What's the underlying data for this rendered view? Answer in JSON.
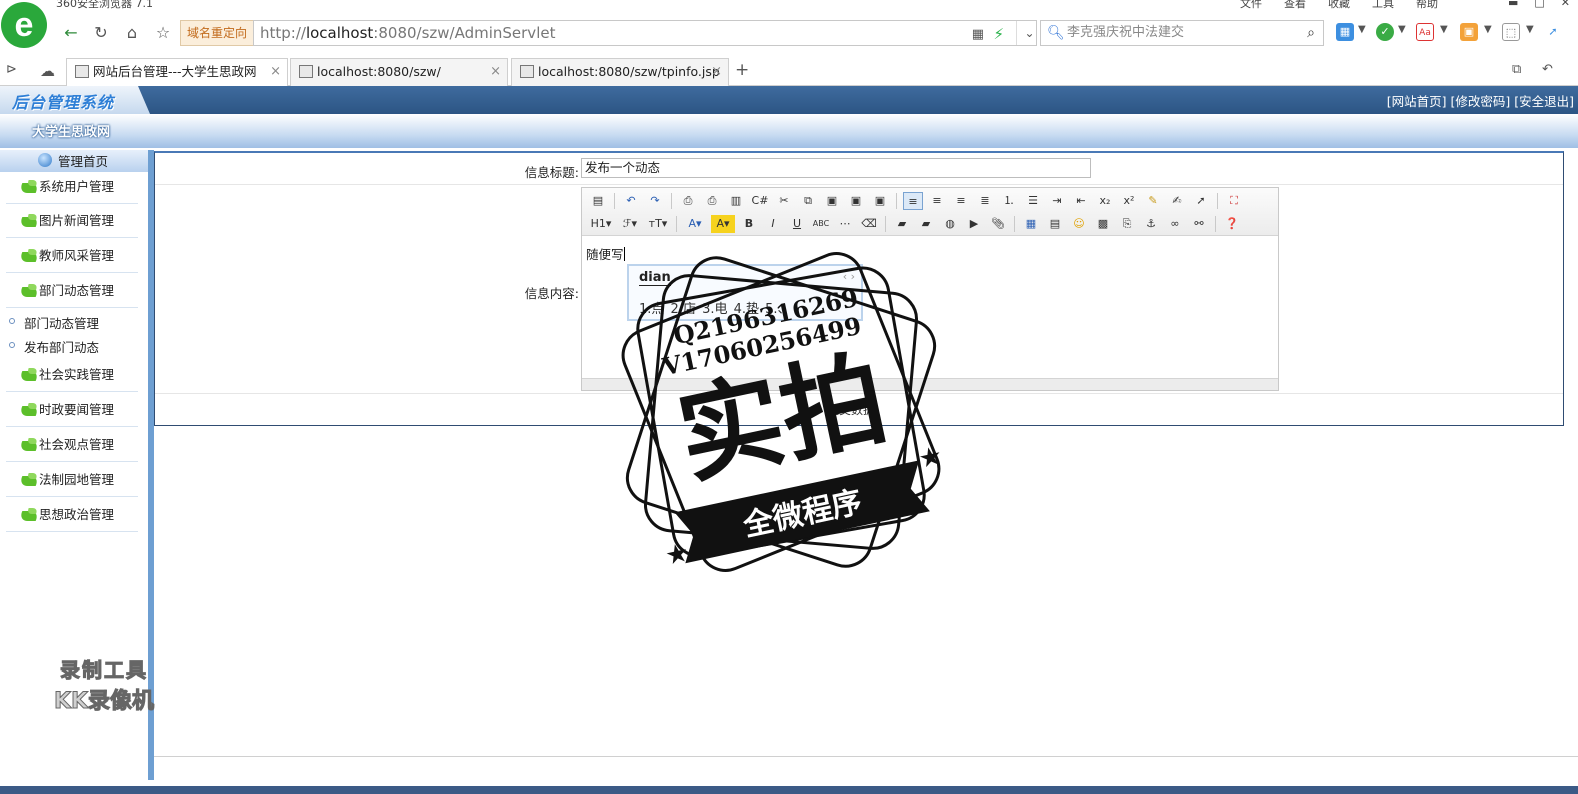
{
  "browser": {
    "title": "360安全浏览器 7.1",
    "menu": [
      "文件",
      "查看",
      "收藏",
      "工具",
      "帮助"
    ],
    "redirect_label": "域名重定向",
    "url_prefix": "http://",
    "url_host": "localhost",
    "url_rest": ":8080/szw/AdminServlet",
    "search_placeholder": "李克强庆祝中法建交",
    "tabs": [
      {
        "label": "网站后台管理---大学生思政网"
      },
      {
        "label": "localhost:8080/szw/"
      },
      {
        "label": "localhost:8080/szw/tpinfo.jsp"
      }
    ]
  },
  "app": {
    "brand": "后台管理系统",
    "top_links": "[网站首页] [修改密码] [安全退出]",
    "site_name": "大学生思政网"
  },
  "sidebar": {
    "home": "管理首页",
    "groups": [
      {
        "label": "系统用户管理"
      },
      {
        "label": "图片新闻管理"
      },
      {
        "label": "教师风采管理"
      },
      {
        "label": "部门动态管理"
      },
      {
        "label": "社会实践管理"
      },
      {
        "label": "时政要闻管理"
      },
      {
        "label": "社会观点管理"
      },
      {
        "label": "法制园地管理"
      },
      {
        "label": "思想政治管理"
      }
    ],
    "subitems": [
      {
        "label": "部门动态管理"
      },
      {
        "label": "发布部门动态"
      }
    ]
  },
  "form": {
    "title_label": "信息标题:",
    "title_value": "发布一个动态",
    "content_label": "信息内容:",
    "content_text": "随便写",
    "ime_pinyin": "dian",
    "ime_candidates": "1.点  2.店  3.电  4.垫  5.、",
    "submit_label": "提交数据"
  },
  "stamp": {
    "line1": "Q2196316269",
    "line2": "V17060256499",
    "main": "实拍",
    "banner": "全微程序"
  },
  "watermark": {
    "line1": "录制工具",
    "line2": "KK录像机"
  },
  "colors": {
    "header_blue": "#2c5584",
    "sidebar_border": "#6e9fd2",
    "logo_green": "#2aa83b"
  }
}
